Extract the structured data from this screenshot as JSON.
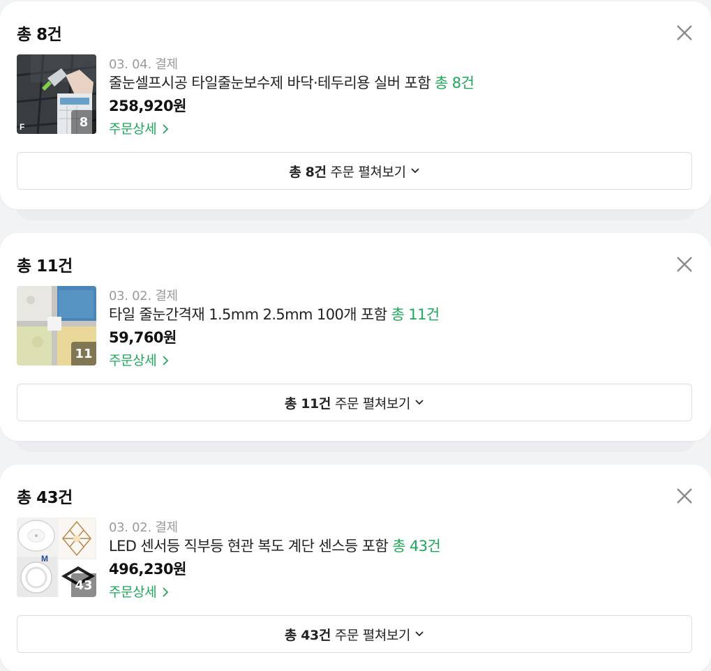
{
  "orders": [
    {
      "title": "총 8건",
      "date": "03. 04. 결제",
      "product_name": "줄눈셀프시공 타일줄눈보수제 바닥·테두리용 실버 포함",
      "product_count": "총 8건",
      "price": "258,920원",
      "thumb_count": "8",
      "detail_label": "주문상세",
      "expand_bold": "총 8건",
      "expand_label": "주문 펼쳐보기"
    },
    {
      "title": "총 11건",
      "date": "03. 02. 결제",
      "product_name": "타일 줄눈간격재 1.5mm 2.5mm 100개 포함",
      "product_count": "총 11건",
      "price": "59,760원",
      "thumb_count": "11",
      "detail_label": "주문상세",
      "expand_bold": "총 11건",
      "expand_label": "주문 펼쳐보기"
    },
    {
      "title": "총 43건",
      "date": "03. 02. 결제",
      "product_name": "LED 센서등 직부등 현관 복도 계단 센스등 포함",
      "product_count": "총 43건",
      "price": "496,230원",
      "thumb_count": "43",
      "detail_label": "주문상세",
      "expand_bold": "총 43건",
      "expand_label": "주문 펼쳐보기"
    }
  ],
  "icons": {
    "close": "close-icon",
    "chevron_right": "chevron-right-icon",
    "chevron_down": "chevron-down-icon"
  },
  "colors": {
    "accent_green": "#1ea85a",
    "muted_gray": "#9a9a9a",
    "background": "#f2f3f5"
  }
}
